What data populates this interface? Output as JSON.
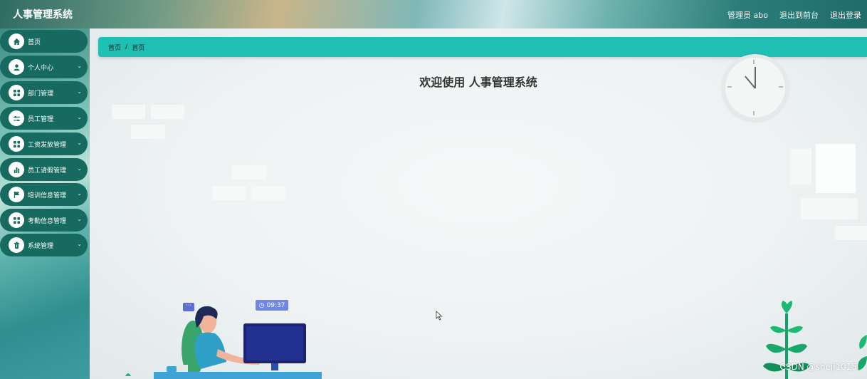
{
  "app": {
    "title": "人事管理系统"
  },
  "header": {
    "user_label": "管理员 abo",
    "to_front_label": "退出到前台",
    "logout_label": "退出登录"
  },
  "sidebar": {
    "items": [
      {
        "label": "首页",
        "icon": "home-icon",
        "expandable": false
      },
      {
        "label": "个人中心",
        "icon": "user-icon",
        "expandable": true
      },
      {
        "label": "部门管理",
        "icon": "grid-icon",
        "expandable": true
      },
      {
        "label": "员工管理",
        "icon": "sliders-icon",
        "expandable": true
      },
      {
        "label": "工资发放管理",
        "icon": "grid-icon",
        "expandable": true
      },
      {
        "label": "员工请假管理",
        "icon": "bar-chart-icon",
        "expandable": true
      },
      {
        "label": "培训信息管理",
        "icon": "flag-icon",
        "expandable": true
      },
      {
        "label": "考勤信息管理",
        "icon": "grid-icon",
        "expandable": true
      },
      {
        "label": "系统管理",
        "icon": "trash-icon",
        "expandable": true
      }
    ]
  },
  "breadcrumb": {
    "items": [
      "首页",
      "首页"
    ],
    "separator": "/"
  },
  "main": {
    "welcome": "欢迎使用 人事管理系统"
  },
  "illustration": {
    "time": "09:37",
    "chat_icon": "chat-bubble-icon",
    "clock_icon": "wall-clock-icon"
  },
  "watermark": "CSDN @sheji1015",
  "colors": {
    "accent": "#1fbfb3",
    "nav_bg": "#166a60",
    "badge": "#6f86e6"
  }
}
